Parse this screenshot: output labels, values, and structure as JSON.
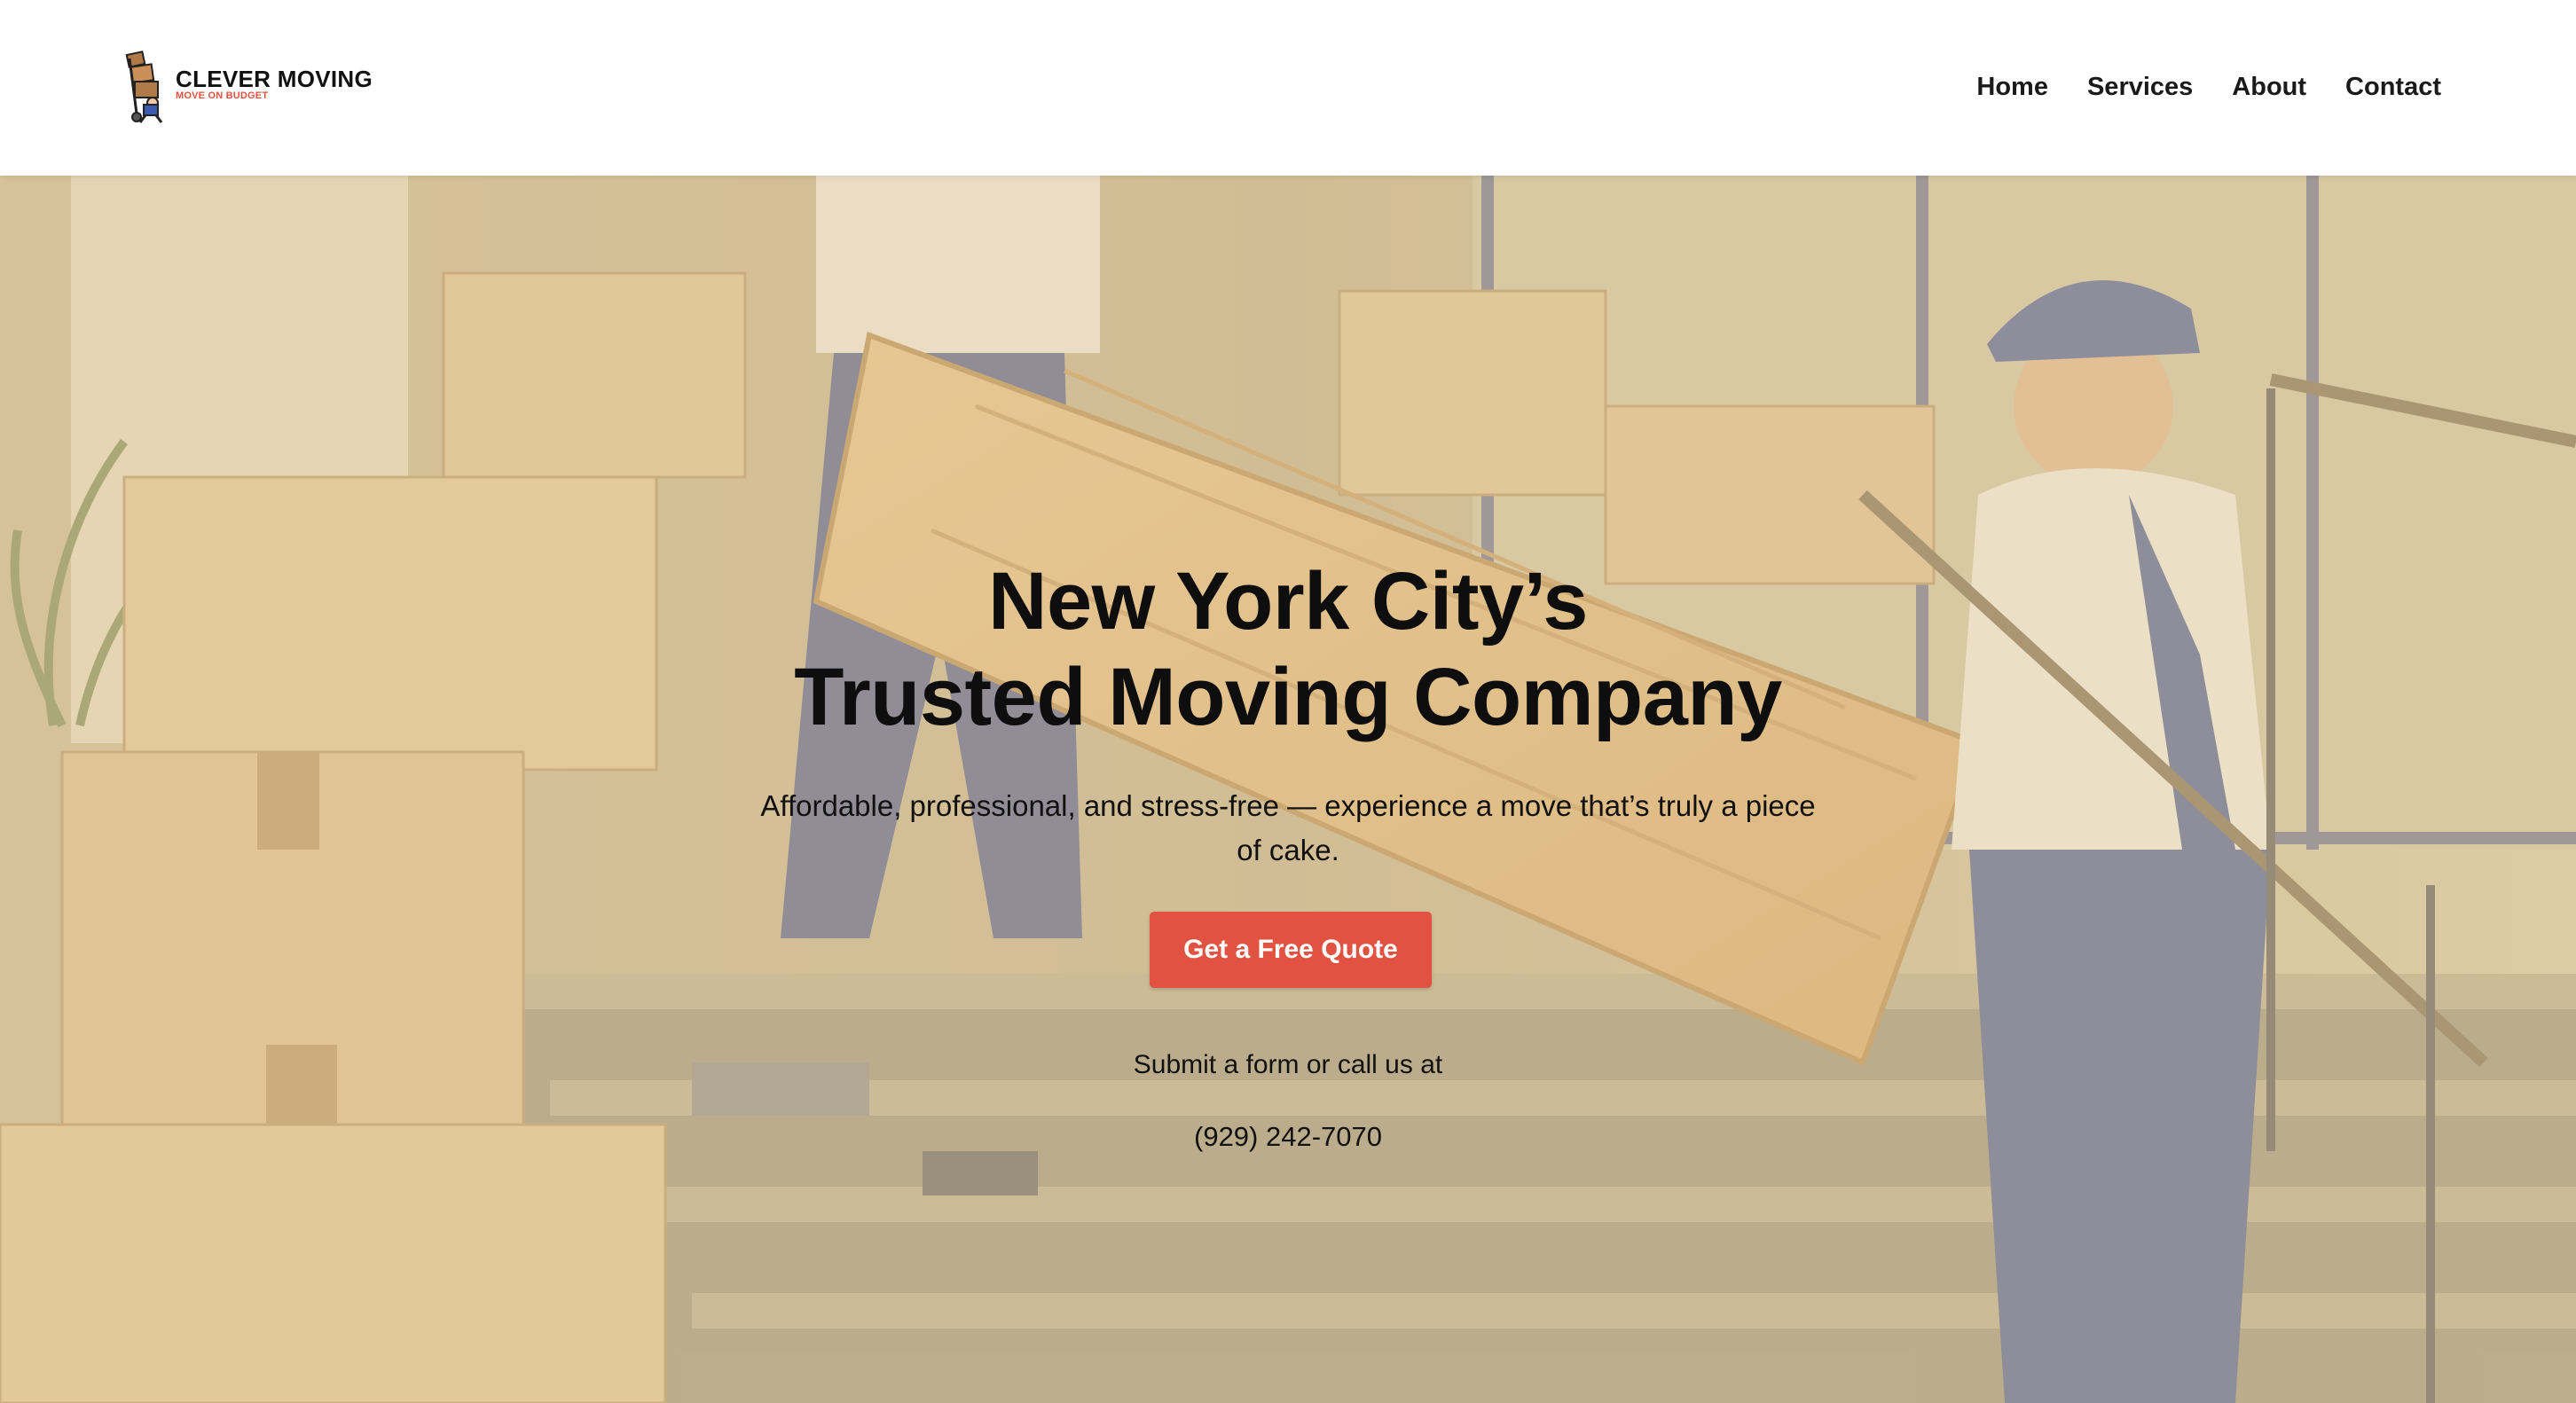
{
  "header": {
    "logo": {
      "name": "CLEVER MOVING",
      "tagline": "MOVE ON BUDGET"
    },
    "nav": [
      {
        "label": "Home"
      },
      {
        "label": "Services"
      },
      {
        "label": "About"
      },
      {
        "label": "Contact"
      }
    ]
  },
  "hero": {
    "title_line1": "New York City’s",
    "title_line2": "Trusted Moving Company",
    "subtitle": "Affordable, professional, and stress-free — experience a move that’s truly a piece of cake.",
    "cta_label": "Get a Free Quote",
    "call_text": "Submit a form or call us at",
    "phone": "(929) 242-7070"
  },
  "colors": {
    "accent": "#e15241",
    "text": "#111111",
    "hero_tint": "#e2cda0"
  },
  "icons": [
    "logo-mover-icon"
  ]
}
